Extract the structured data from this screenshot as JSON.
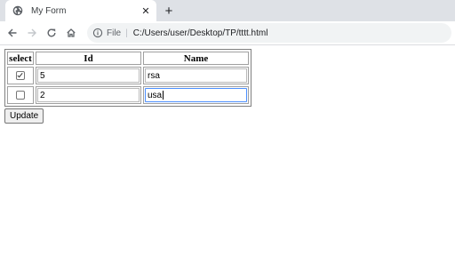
{
  "browser": {
    "tab": {
      "title": "My Form",
      "icon": "globe-icon",
      "close_icon": "close-icon"
    },
    "new_tab_icon": "plus-icon",
    "toolbar": {
      "back_icon": "back-arrow-icon",
      "forward_icon": "forward-arrow-icon",
      "reload_icon": "reload-icon",
      "home_icon": "home-icon",
      "info_icon": "info-icon",
      "scheme_label": "File",
      "url": "C:/Users/user/Desktop/TP/tttt.html"
    }
  },
  "form": {
    "headers": [
      "select",
      "Id",
      "Name"
    ],
    "rows": [
      {
        "checked": true,
        "id": "5",
        "name": "rsa"
      },
      {
        "checked": false,
        "id": "2",
        "name": "usa"
      }
    ],
    "update_label": "Update"
  },
  "colors": {
    "focus_border": "#4d90fe",
    "tabstrip_bg": "#dee1e6",
    "omnibox_bg": "#f1f3f4"
  }
}
